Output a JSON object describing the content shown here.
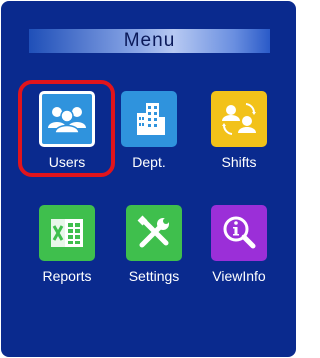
{
  "title": "Menu",
  "colors": {
    "background": "#0a2a8e",
    "selection_ring": "#e1141c",
    "users": "#2f93dd",
    "dept": "#2f93dd",
    "shifts": "#f2c21a",
    "reports": "#3fbf4d",
    "settings": "#3fbf4d",
    "viewinfo": "#9b2fd8"
  },
  "selected_item": "Users",
  "items": [
    {
      "label": "Users",
      "icon": "users-icon"
    },
    {
      "label": "Dept.",
      "icon": "building-icon"
    },
    {
      "label": "Shifts",
      "icon": "shift-swap-icon"
    },
    {
      "label": "Reports",
      "icon": "spreadsheet-icon"
    },
    {
      "label": "Settings",
      "icon": "tools-icon"
    },
    {
      "label": "ViewInfo",
      "icon": "magnifier-info-icon"
    }
  ]
}
